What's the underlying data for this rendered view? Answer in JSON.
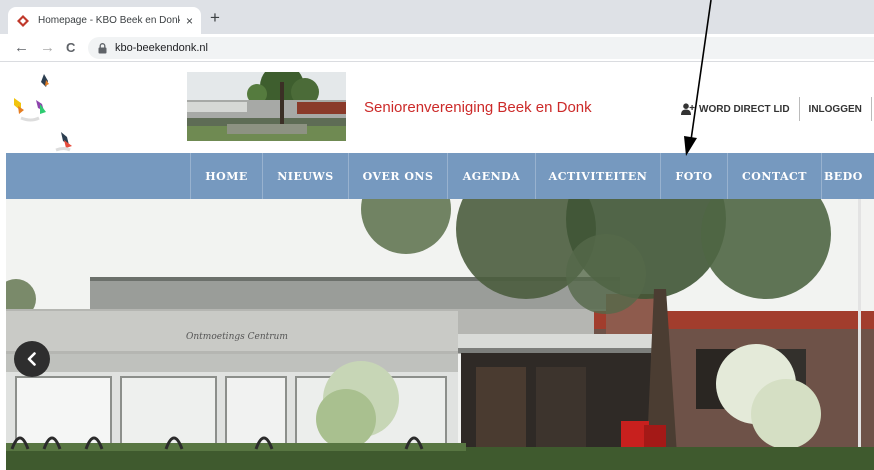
{
  "browser": {
    "tab_title": "Homepage - KBO Beek en Donk",
    "close_glyph": "×",
    "new_tab_glyph": "+",
    "back_glyph": "←",
    "forward_glyph": "→",
    "reload_glyph": "C",
    "url": "kbo-beekendonk.nl"
  },
  "header": {
    "site_title": "Seniorenvereniging Beek en Donk",
    "links": {
      "join": "WORD DIRECT LID",
      "login": "INLOGGEN"
    }
  },
  "nav": {
    "items": [
      "HOME",
      "NIEUWS",
      "OVER ONS",
      "AGENDA",
      "ACTIVITEITEN",
      "FOTO",
      "CONTACT",
      "BEDO"
    ]
  },
  "hero": {
    "building_sign": "Ontmoetings Centrum",
    "prev_glyph": "‹"
  },
  "colors": {
    "nav_bg": "#7699bf",
    "title_red": "#cc2a29"
  },
  "icons": [
    "kbo-favicon-icon",
    "lock-icon",
    "logo-birds-icon",
    "user-plus-icon",
    "chevron-left-icon"
  ]
}
